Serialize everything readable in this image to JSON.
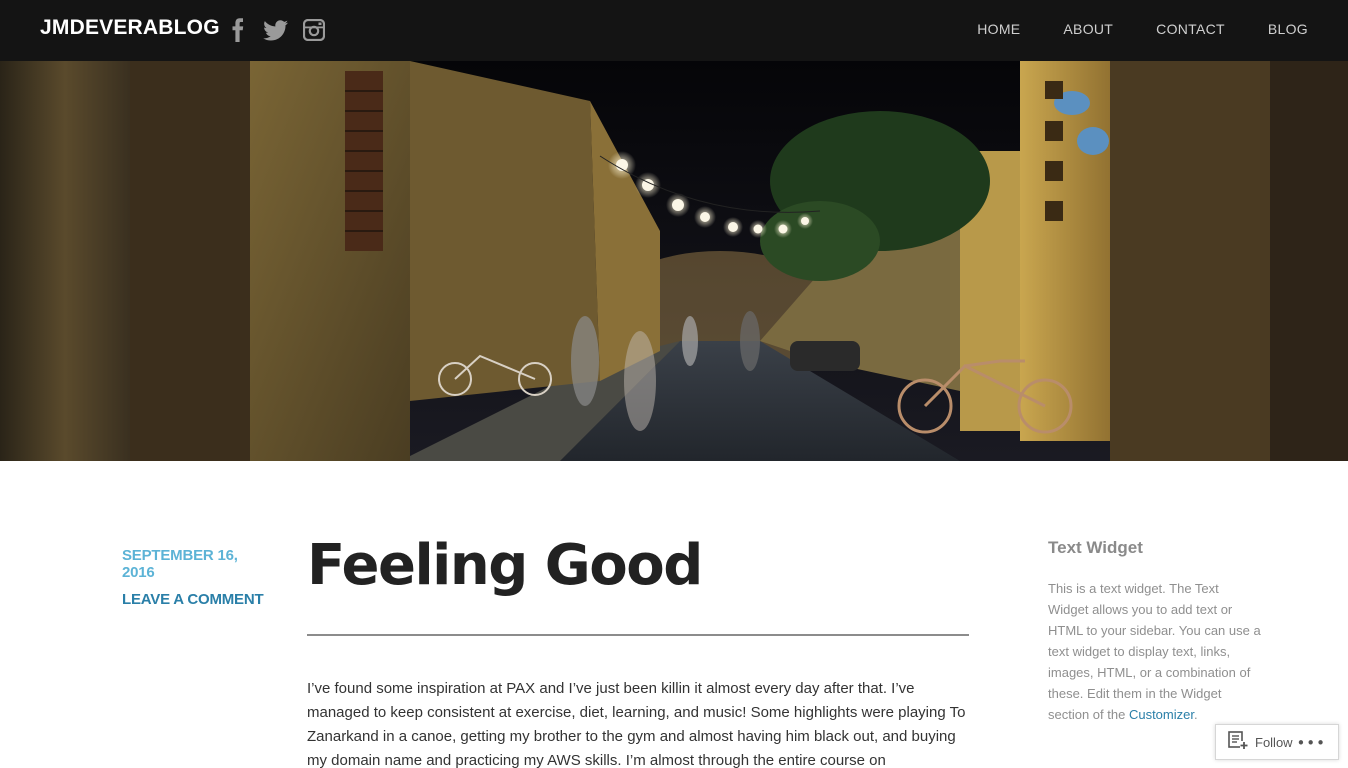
{
  "header": {
    "site_title": "JMDEVERABLOG",
    "social": [
      {
        "icon": "facebook-icon"
      },
      {
        "icon": "twitter-icon"
      },
      {
        "icon": "instagram-icon"
      }
    ],
    "nav": [
      "HOME",
      "ABOUT",
      "CONTACT",
      "BLOG"
    ]
  },
  "hero": {
    "icon": "hero-street-photo"
  },
  "post": {
    "date": "SEPTEMBER 16, 2016",
    "comment_link": "LEAVE A COMMENT",
    "title": "Feeling Good",
    "body": "I’ve found some inspiration at PAX and I’ve just been killin it almost every day after that. I’ve managed to keep consistent at exercise, diet, learning, and music! Some highlights were playing To Zanarkand in a canoe, getting my brother to the gym and almost having him black out, and buying my domain name and practicing my AWS skills. I’m almost through the entire course on"
  },
  "sidebar": {
    "widget_title": "Text Widget",
    "widget_text": "This is a text widget. The Text Widget allows you to add text or HTML to your sidebar. You can use a text widget to display text, links, images, HTML, or a combination of these. Edit them in the Widget section of the",
    "widget_link": "Customizer",
    "widget_end": "."
  },
  "follow": {
    "label": "Follow",
    "more": "•••"
  },
  "colors": {
    "topbar": "#141414",
    "date": "#5cb3d6",
    "link": "#2a7fa8",
    "title": "#222222"
  }
}
